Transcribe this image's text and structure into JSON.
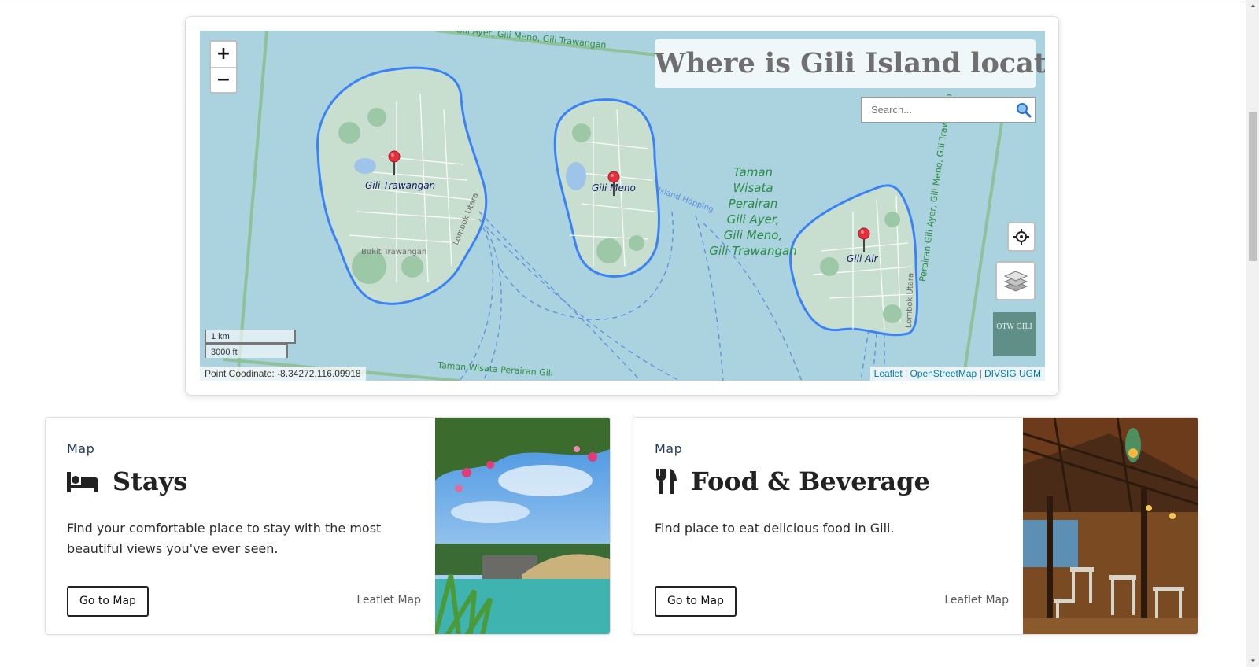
{
  "map": {
    "title": "Where is Gili Island located?",
    "search": {
      "placeholder": "Search..."
    },
    "zoom": {
      "in_label": "+",
      "out_label": "−"
    },
    "labels": {
      "gili_trawangan": "Gili Trawangan",
      "gili_meno": "Gili Meno",
      "gili_air": "Gili Air",
      "bukit_trawangan": "Bukit Trawangan",
      "lombok_utara_1": "Lombok Utara",
      "lombok_utara_2": "Lombok Utara",
      "island_hopping": "Island Hopping",
      "park_area": "Taman Wisata Perairan Gili Ayer, Gili Meno, Gili Trawangan",
      "top_road": "Gili Ayer, Gili Meno, Gili Trawangan",
      "bottom_road": "Taman Wisata Perairan Gili",
      "right_road": "Perairan Gili Ayer, Gili Meno, Gili Trawangan"
    },
    "park_lines": [
      "Taman",
      "Wisata",
      "Perairan",
      "Gili Ayer,",
      "Gili Meno,",
      "Gili Trawangan"
    ],
    "scale": {
      "km": "1 km",
      "ft": "3000 ft"
    },
    "coordinate_text": "Point Coodinate: -8.34272,116.09918",
    "attribution": {
      "leaflet": "Leaflet",
      "sep1": " | ",
      "osm": "OpenStreetMap",
      "sep2": " | ",
      "divsig": "DIVSIG UGM"
    },
    "logo_text": "OTW GILI",
    "colors": {
      "water": "#aad3df",
      "island_outline": "#3b82f6",
      "marker": "#e3303c",
      "land": "#c8dfcf"
    }
  },
  "cards": [
    {
      "kicker": "Map",
      "title": "Stays",
      "icon": "bed-icon",
      "description": "Find your comfortable place to stay with the most beautiful views you've ever seen.",
      "button_label": "Go to Map",
      "meta": "Leaflet Map"
    },
    {
      "kicker": "Map",
      "title": "Food & Beverage",
      "icon": "utensils-icon",
      "description": "Find place to eat delicious food in Gili.",
      "button_label": "Go to Map",
      "meta": "Leaflet Map"
    }
  ]
}
